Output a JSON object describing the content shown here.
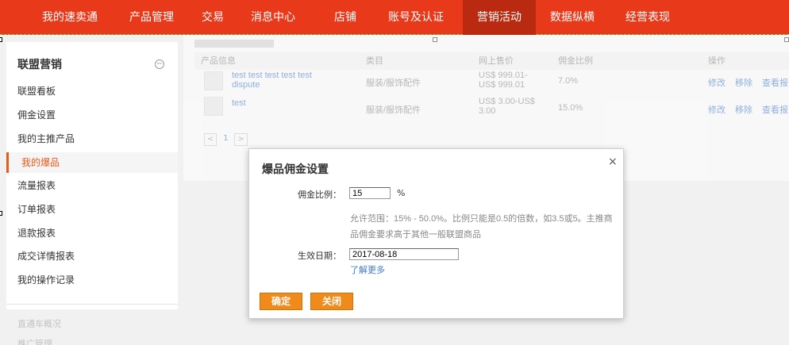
{
  "topnav": {
    "items": [
      {
        "label": "我的速卖通"
      },
      {
        "label": "产品管理"
      },
      {
        "label": "交易"
      },
      {
        "label": "消息中心"
      },
      {
        "label": "店铺"
      },
      {
        "label": "账号及认证"
      },
      {
        "label": "营销活动",
        "active": true
      },
      {
        "label": "数据纵横"
      },
      {
        "label": "经营表现"
      }
    ]
  },
  "sidebar": {
    "title": "联盟营销",
    "collapse_glyph": "−",
    "items": [
      {
        "label": "联盟看板"
      },
      {
        "label": "佣金设置"
      },
      {
        "label": "我的主推产品"
      },
      {
        "label": "我的爆品",
        "active": true
      },
      {
        "label": "流量报表"
      },
      {
        "label": "订单报表"
      },
      {
        "label": "退款报表"
      },
      {
        "label": "成交详情报表"
      },
      {
        "label": "我的操作记录"
      }
    ],
    "extra": [
      "直通车概况",
      "推广管理"
    ]
  },
  "table": {
    "headers": [
      "产品信息",
      "类目",
      "网上售价",
      "佣金比例",
      "操作"
    ],
    "rows": [
      {
        "name": "test test test test test dispute",
        "category": "服装/服饰配件",
        "price": "US$ 999.01-US$ 999.01",
        "commission": "7.0%",
        "actions": [
          "修改",
          "移除",
          "查看报"
        ]
      },
      {
        "name": "test",
        "category": "服装/服饰配件",
        "price": "US$ 3.00-US$ 3.00",
        "commission": "15.0%",
        "actions": [
          "修改",
          "移除",
          "查看报"
        ]
      }
    ],
    "pager": {
      "prev": "<",
      "page": "1",
      "next": ">"
    }
  },
  "dialog": {
    "title": "爆品佣金设置",
    "close_glyph": "×",
    "commission_label": "佣金比例：",
    "commission_value": "15",
    "commission_unit": "%",
    "hint": "允许范围：15% - 50.0%。比例只能是0.5的倍数，如3.5或5。主推商品佣金要求高于其他一般联盟商品",
    "date_label": "生效日期：",
    "date_value": "2017-08-18",
    "learn_more": "了解更多",
    "confirm_label": "确定",
    "close_label": "关闭"
  },
  "colors": {
    "nav_bg": "#e8391a",
    "nav_active": "#b92a10",
    "accent": "#e8591a",
    "button": "#f08a1a",
    "link": "#3d7bd1"
  }
}
